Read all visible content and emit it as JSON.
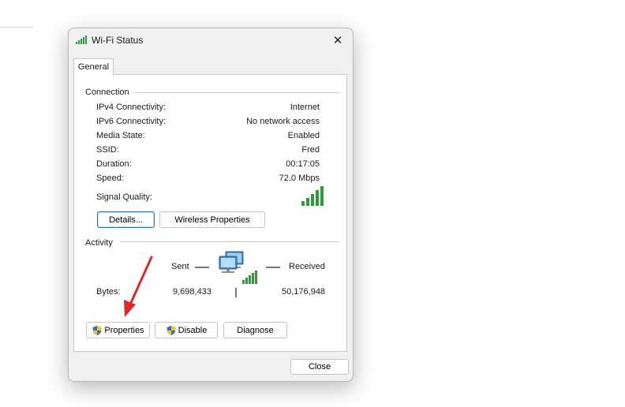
{
  "window": {
    "title": "Wi-Fi Status",
    "tab": "General"
  },
  "connection": {
    "heading": "Connection",
    "rows": [
      {
        "label": "IPv4 Connectivity:",
        "value": "Internet"
      },
      {
        "label": "IPv6 Connectivity:",
        "value": "No network access"
      },
      {
        "label": "Media State:",
        "value": "Enabled"
      },
      {
        "label": "SSID:",
        "value": "Fred"
      },
      {
        "label": "Duration:",
        "value": "00:17:05"
      },
      {
        "label": "Speed:",
        "value": "72.0 Mbps"
      }
    ],
    "signal_label": "Signal Quality:",
    "signal_bars": 5,
    "signal_bars_max": 5,
    "details_button": "Details...",
    "wireless_button": "Wireless Properties"
  },
  "activity": {
    "heading": "Activity",
    "sent_label": "Sent",
    "received_label": "Received",
    "bytes_label": "Bytes:",
    "bytes_sent": "9,698,433",
    "bytes_received": "50,176,948"
  },
  "buttons": {
    "properties": "Properties",
    "disable": "Disable",
    "diagnose": "Diagnose",
    "close": "Close"
  },
  "icons": {
    "title": "wifi-signal-icon",
    "signal": "signal-bars-icon",
    "network": "network-computer-icon",
    "shield": "uac-shield-icon",
    "close": "close-icon",
    "annotation": "red-arrow-annotation"
  },
  "colors": {
    "signal_green": "#2e9a3a",
    "arrow_red": "#e0282c",
    "focus_blue": "#2b6ea8"
  }
}
